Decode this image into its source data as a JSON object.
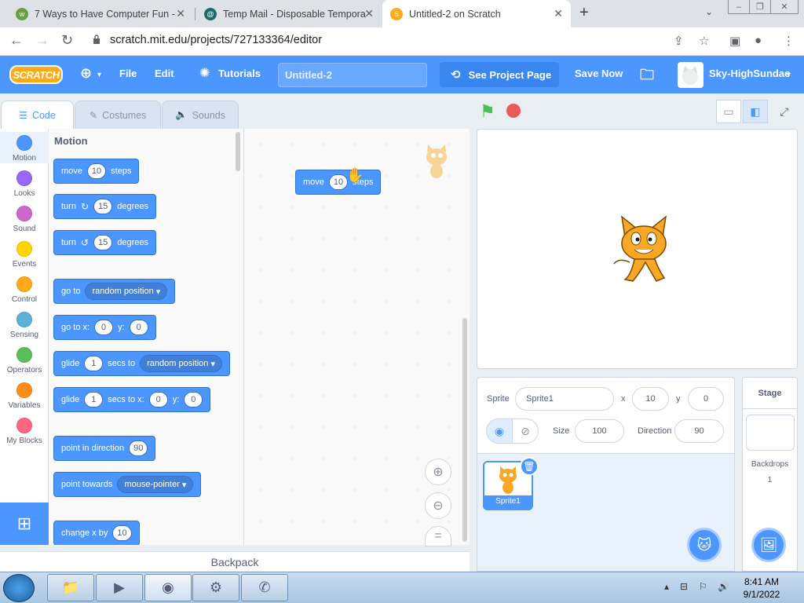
{
  "browser": {
    "tabs": [
      {
        "title": "7 Ways to Have Computer Fun -"
      },
      {
        "title": "Temp Mail - Disposable Tempora"
      },
      {
        "title": "Untitled-2 on Scratch"
      }
    ],
    "url": "scratch.mit.edu/projects/727133364/editor"
  },
  "menubar": {
    "logo": "SCRATCH",
    "file": "File",
    "edit": "Edit",
    "tutorials": "Tutorials",
    "project_title": "Untitled-2",
    "see_project_page": "See Project Page",
    "save_now": "Save Now",
    "username": "Sky-HighSundae"
  },
  "editor_tabs": {
    "code": "Code",
    "costumes": "Costumes",
    "sounds": "Sounds"
  },
  "categories": [
    {
      "label": "Motion",
      "color": "#4c97ff"
    },
    {
      "label": "Looks",
      "color": "#9966ff"
    },
    {
      "label": "Sound",
      "color": "#cf63cf"
    },
    {
      "label": "Events",
      "color": "#ffd500"
    },
    {
      "label": "Control",
      "color": "#ffab19"
    },
    {
      "label": "Sensing",
      "color": "#5cb1d6"
    },
    {
      "label": "Operators",
      "color": "#59c059"
    },
    {
      "label": "Variables",
      "color": "#ff8c1a"
    },
    {
      "label": "My Blocks",
      "color": "#ff6680"
    }
  ],
  "palette": {
    "title": "Motion",
    "move": {
      "a": "move",
      "n": "10",
      "b": "steps"
    },
    "turn_right": {
      "a": "turn",
      "n": "15",
      "b": "degrees"
    },
    "turn_left": {
      "a": "turn",
      "n": "15",
      "b": "degrees"
    },
    "goto": {
      "a": "go to",
      "opt": "random position"
    },
    "gotoxy": {
      "a": "go to x:",
      "x": "0",
      "b": "y:",
      "y": "0"
    },
    "glide": {
      "a": "glide",
      "n": "1",
      "b": "secs to",
      "opt": "random position"
    },
    "glidexy": {
      "a": "glide",
      "n": "1",
      "b": "secs to x:",
      "x": "0",
      "c": "y:",
      "y": "0"
    },
    "point_dir": {
      "a": "point in direction",
      "n": "90"
    },
    "point_towards": {
      "a": "point towards",
      "opt": "mouse-pointer"
    },
    "change_x": {
      "a": "change x by",
      "n": "10"
    }
  },
  "script_block": {
    "a": "move",
    "n": "10",
    "b": "steps"
  },
  "backpack": "Backpack",
  "sprite_info": {
    "sprite_label": "Sprite",
    "sprite_name": "Sprite1",
    "x_label": "x",
    "x": "10",
    "y_label": "y",
    "y": "0",
    "show_label": "Show",
    "size_label": "Size",
    "size": "100",
    "direction_label": "Direction",
    "direction": "90"
  },
  "sprite_list": [
    {
      "name": "Sprite1"
    }
  ],
  "stage_pane": {
    "title": "Stage",
    "backdrops_label": "Backdrops",
    "backdrops_count": "1"
  },
  "taskbar": {
    "time": "8:41 AM",
    "date": "9/1/2022"
  }
}
